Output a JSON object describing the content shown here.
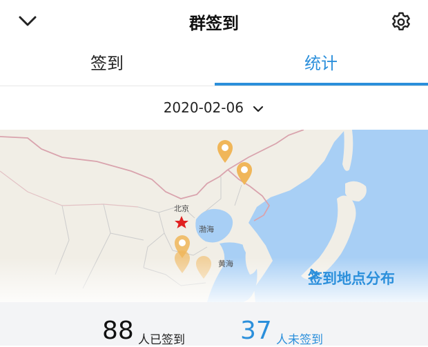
{
  "header": {
    "title": "群签到",
    "back_icon": "chevron-down-icon",
    "settings_icon": "gear-icon"
  },
  "tabs": [
    {
      "label": "签到",
      "active": false
    },
    {
      "label": "统计",
      "active": true
    }
  ],
  "date": {
    "value": "2020-02-06",
    "icon": "chevron-down-icon"
  },
  "map": {
    "city_label": "北京",
    "sea_label_bohai": "渤海",
    "sea_label_huanghai": "黄海",
    "link_label": "签到地点分布",
    "link_icon": "chevron-right-icon",
    "colors": {
      "land": "#f1eee6",
      "sea": "#a8cff5",
      "border": "#d9a3ad",
      "pin": "#f0b659",
      "star": "#e02020"
    }
  },
  "stats": {
    "signed_count": "88",
    "signed_label": "人已签到",
    "unsigned_count": "37",
    "unsigned_label": "人未签到",
    "accent": "#2b8fdb"
  }
}
